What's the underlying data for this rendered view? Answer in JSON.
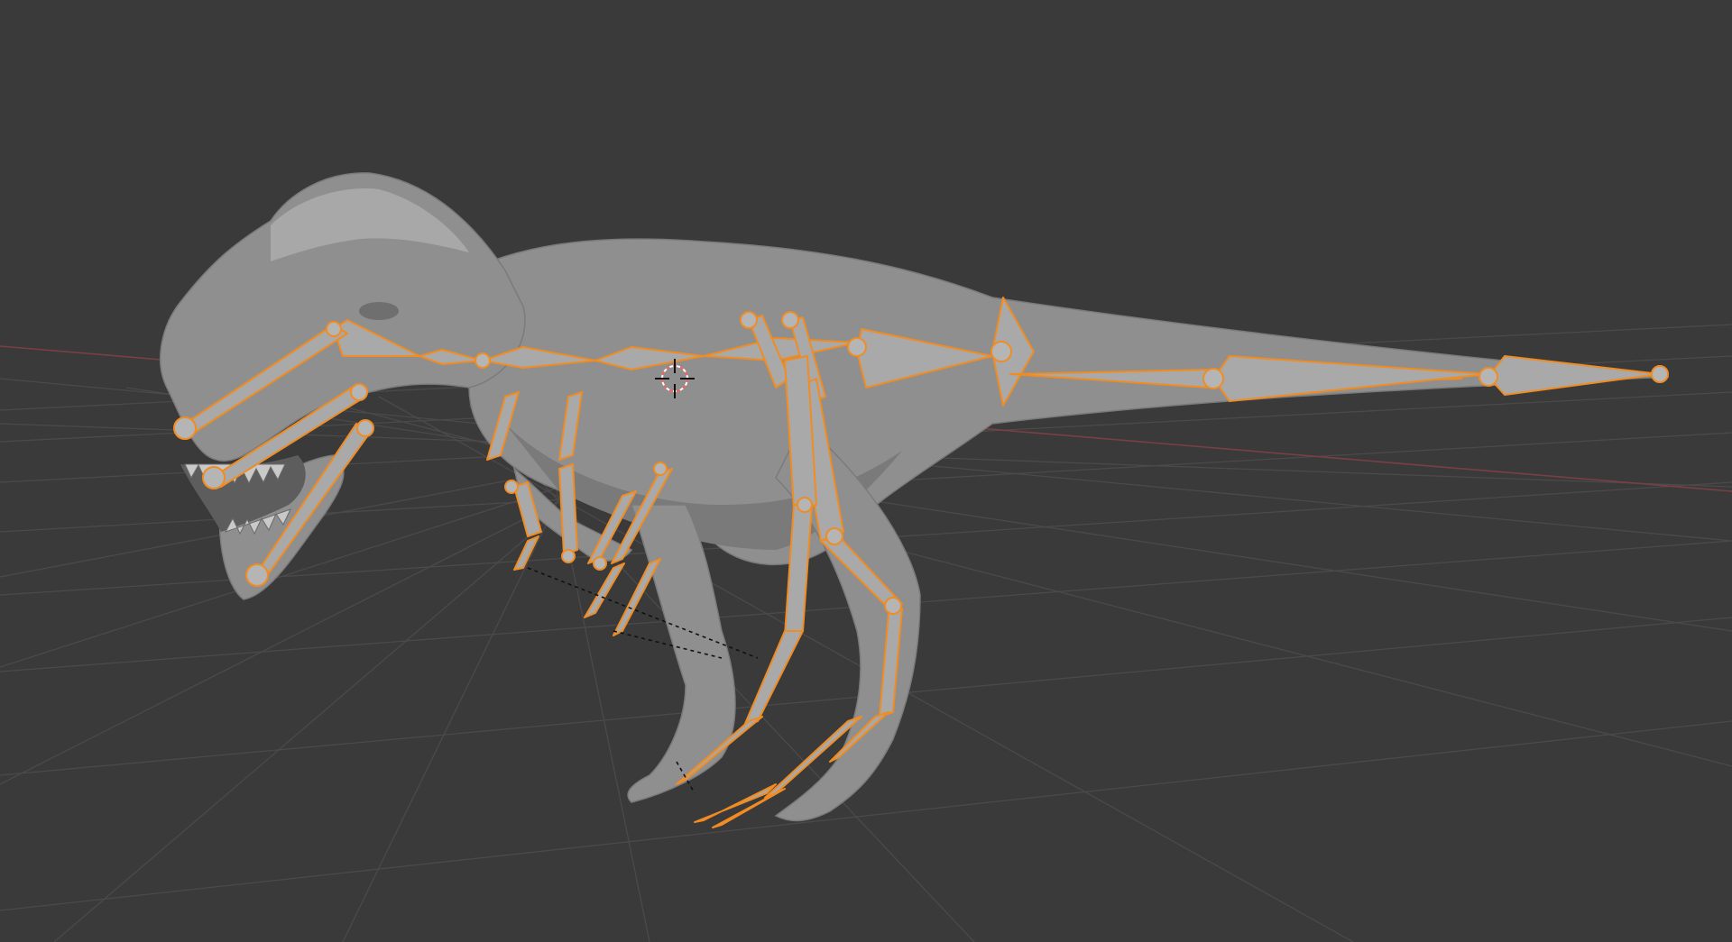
{
  "viewport": {
    "background": "#393939",
    "grid_color": "#4a4a4a",
    "x_axis_color": "#7a3f45",
    "selection_color": "#f08c22",
    "model": "t-rex-mesh",
    "armature": "t-rex-armature",
    "cursor_icon": "3d-cursor-icon"
  }
}
